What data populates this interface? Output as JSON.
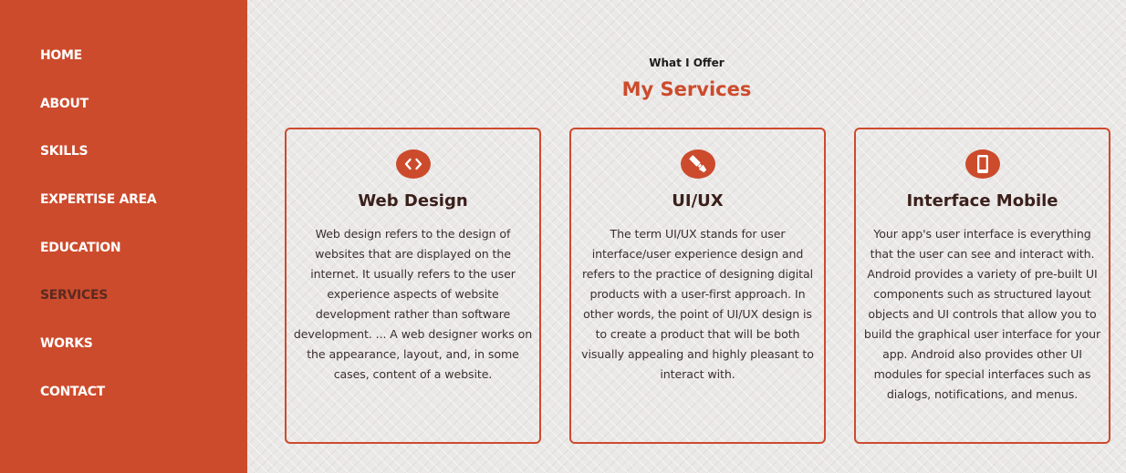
{
  "nav": {
    "items": [
      {
        "label": "HOME"
      },
      {
        "label": "ABOUT"
      },
      {
        "label": "SKILLS"
      },
      {
        "label": "EXPERTISE AREA"
      },
      {
        "label": "EDUCATION"
      },
      {
        "label": "SERVICES",
        "active": true
      },
      {
        "label": "WORKS"
      },
      {
        "label": "CONTACT"
      }
    ]
  },
  "services": {
    "eyebrow": "What I Offer",
    "title": "My Services",
    "cards": [
      {
        "icon": "code-icon",
        "title": "Web Design",
        "text": "Web design refers to the design of websites that are displayed on the internet. It usually refers to the user experience aspects of website development rather than software development. ... A web designer works on the appearance, layout, and, in some cases, content of a website."
      },
      {
        "icon": "paint-brush-icon",
        "title": "UI/UX",
        "text": "The term UI/UX stands for user interface/user experience design and refers to the practice of designing digital products with a user-first approach. In other words, the point of UI/UX design is to create a product that will be both visually appealing and highly pleasant to interact with."
      },
      {
        "icon": "mobile-icon",
        "title": "Interface Mobile",
        "text": "Your app's user interface is everything that the user can see and interact with. Android provides a variety of pre-built UI components such as structured layout objects and UI controls that allow you to build the graphical user interface for your app. Android also provides other UI modules for special interfaces such as dialogs, notifications, and menus."
      }
    ]
  },
  "colors": {
    "accent": "#cc4b2c",
    "background": "#ebe9e8",
    "active_nav": "#5a2a20"
  }
}
